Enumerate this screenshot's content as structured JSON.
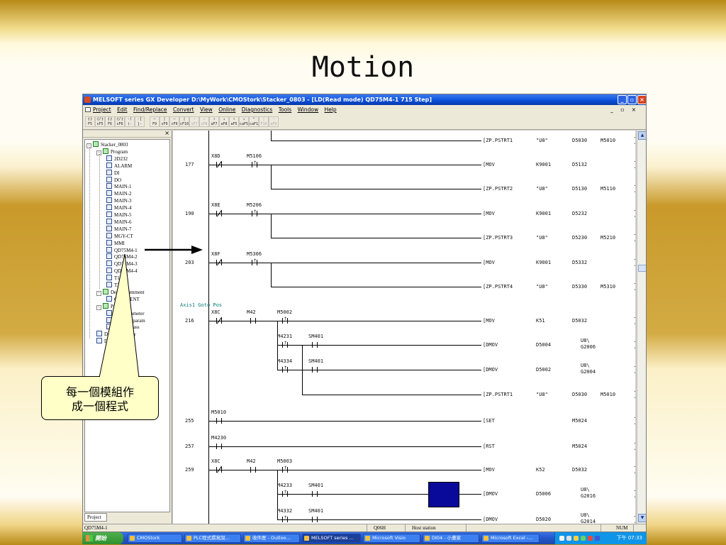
{
  "slide": {
    "title": "Motion"
  },
  "window": {
    "title": "MELSOFT series GX Developer D:\\MyWork\\CMOStork\\Stacker_0803 - [LD(Read mode)   QD75M4-1   715 Step]",
    "menus": [
      "Project",
      "Edit",
      "Find/Replace",
      "Convert",
      "View",
      "Online",
      "Diagnostics",
      "Tools",
      "Window",
      "Help"
    ],
    "mdi_controls": "_ ▫ ×",
    "minimize_glyph": "_",
    "maximize_glyph": "▫",
    "close_glyph": "×"
  },
  "toolbar": {
    "buttons": [
      {
        "top": "┤├",
        "bottom": "F5"
      },
      {
        "top": "┤/├",
        "bottom": "sF5"
      },
      {
        "top": "┤├",
        "bottom": "F6"
      },
      {
        "top": "┤/├",
        "bottom": "sF6"
      },
      {
        "top": "-( )-",
        "bottom": "F7"
      },
      {
        "top": "-[ ]-",
        "bottom": "F8"
      },
      {
        "top": "—",
        "bottom": "F9"
      },
      {
        "top": "|",
        "bottom": "sF9"
      },
      {
        "top": "—",
        "bottom": "cF9"
      },
      {
        "top": "|",
        "bottom": "cF10"
      },
      {
        "top": "↑",
        "bottom": "sF7"
      },
      {
        "top": "↓",
        "bottom": "sF8"
      },
      {
        "top": "↑",
        "bottom": "aF7"
      },
      {
        "top": "↓",
        "bottom": "aF8"
      },
      {
        "top": "↑",
        "bottom": "aF5"
      },
      {
        "top": "↓",
        "bottom": "caF5"
      },
      {
        "top": "⌃",
        "bottom": "caF10"
      },
      {
        "top": "|",
        "bottom": "F10"
      },
      {
        "top": "—",
        "bottom": "aF9"
      }
    ]
  },
  "project_panel": {
    "close_glyph": "×",
    "tab": "Project",
    "tree": [
      {
        "label": "Stacker_0803",
        "level": 0,
        "exp": "-",
        "icon": "folder"
      },
      {
        "label": "Program",
        "level": 1,
        "exp": "-",
        "icon": "folder"
      },
      {
        "label": "2D232",
        "level": 2
      },
      {
        "label": "ALARM",
        "level": 2
      },
      {
        "label": "DI",
        "level": 2
      },
      {
        "label": "DO",
        "level": 2
      },
      {
        "label": "MAIN-1",
        "level": 2
      },
      {
        "label": "MAIN-2",
        "level": 2
      },
      {
        "label": "MAIN-3",
        "level": 2
      },
      {
        "label": "MAIN-4",
        "level": 2
      },
      {
        "label": "MAIN-5",
        "level": 2
      },
      {
        "label": "MAIN-6",
        "level": 2
      },
      {
        "label": "MAIN-7",
        "level": 2
      },
      {
        "label": "MGY-CT",
        "level": 2
      },
      {
        "label": "MMI",
        "level": 2
      },
      {
        "label": "QD75M4-1",
        "level": 2
      },
      {
        "label": "QD75M4-2",
        "level": 2
      },
      {
        "label": "QD75M4-3",
        "level": 2
      },
      {
        "label": "QD75M4-4",
        "level": 2
      },
      {
        "label": "T1-CT",
        "level": 2
      },
      {
        "label": "T2-CT",
        "level": 2
      },
      {
        "label": "Device comment",
        "level": 1,
        "exp": "-",
        "icon": "folder"
      },
      {
        "label": "COMMENT",
        "level": 2
      },
      {
        "label": "Parameter",
        "level": 1,
        "exp": "-",
        "icon": "folder"
      },
      {
        "label": "PLC parameter",
        "level": 2
      },
      {
        "label": "Network param",
        "level": 2
      },
      {
        "label": "Remote pass",
        "level": 2
      },
      {
        "label": "Device memory",
        "level": 1
      },
      {
        "label": "Device init",
        "level": 1
      }
    ]
  },
  "ladder": {
    "comment": "Axis1 Goto Pos",
    "step_numbers": [
      "177",
      "190",
      "203",
      "216",
      "255",
      "257",
      "259"
    ],
    "rows": [
      {
        "instr": "[ZP.PSTRT1",
        "a": "\"U8\"",
        "b": "D5030",
        "c": "M5010"
      },
      {
        "instr": "[MOV",
        "a": "K9001",
        "b": "D5132"
      },
      {
        "instr": "[ZP.PSTRT2",
        "a": "\"U8\"",
        "b": "D5130",
        "c": "M5110"
      },
      {
        "instr": "[MOV",
        "a": "K9001",
        "b": "D5232"
      },
      {
        "instr": "[ZP.PSTRT3",
        "a": "\"U8\"",
        "b": "D5230",
        "c": "M5210"
      },
      {
        "instr": "[MOV",
        "a": "K9001",
        "b": "D5332"
      },
      {
        "instr": "[ZP.PSTRT4",
        "a": "\"U8\"",
        "b": "D5330",
        "c": "M5310"
      },
      {
        "instr": "[MOV",
        "a": "K51",
        "b": "D5032"
      },
      {
        "instr": "[DMOV",
        "a": "D5004",
        "b": "U8\\",
        "b2": "G2006"
      },
      {
        "instr": "[DMOV",
        "a": "D5002",
        "b": "U8\\",
        "b2": "G2004"
      },
      {
        "instr": "[ZP.PSTRT1",
        "a": "\"U8\"",
        "b": "D5030",
        "c": "M5010"
      },
      {
        "instr": "[SET",
        "b": "M5024"
      },
      {
        "instr": "[RST",
        "b": "M5024"
      },
      {
        "instr": "[MOV",
        "a": "K52",
        "b": "D5032"
      },
      {
        "instr": "[DMOV",
        "a": "D5006",
        "b": "U8\\",
        "b2": "G2016"
      },
      {
        "instr": "[DMOV",
        "a": "D5020",
        "b": "U8\\",
        "b2": "G2014"
      }
    ],
    "contacts": [
      "X8D",
      "M5106",
      "X8E",
      "M5206",
      "X8F",
      "M5306",
      "X8C",
      "M42",
      "M5002",
      "M4231",
      "SM401",
      "M4334",
      "SM401",
      "M5010",
      "M4230",
      "X8C",
      "M42",
      "M5003",
      "M4233",
      "SM401",
      "M4332",
      "SM401"
    ]
  },
  "statusbar": {
    "program": "QD75M4-1",
    "cpu": "Q06H",
    "station": "Host station",
    "num": "NUM"
  },
  "taskbar": {
    "start": "開始",
    "tasks": [
      "CMOStork",
      "PLC程式撰寫說...",
      "收件匣 - Outloo...",
      "MELSOFT series ...",
      "Microsoft Visio",
      "DI04 - 小畫家",
      "Microsoft Excel -..."
    ],
    "active_task": 3,
    "clock": "下午 07:33"
  },
  "callout": {
    "text": "每一個模組作\n成一個程式"
  },
  "colors": {
    "accent": "#0a4fd8",
    "gold": "#c99a2a",
    "callout": "#ffffc8",
    "highlight_box": "#0a0a9a"
  }
}
